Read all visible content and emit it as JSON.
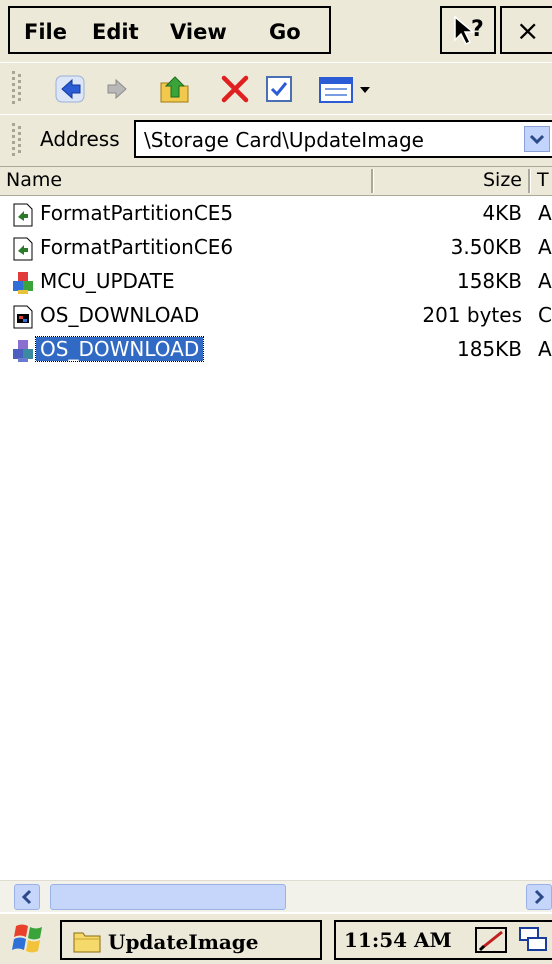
{
  "menu": {
    "file": "File",
    "edit": "Edit",
    "view": "View",
    "go": "Go",
    "help_icon": "help-arrow-icon",
    "close_label": "×"
  },
  "address": {
    "label": "Address",
    "value": "\\Storage Card\\UpdateImage"
  },
  "columns": {
    "name": "Name",
    "size": "Size",
    "type": "T"
  },
  "files": [
    {
      "name": "FormatPartitionCE5",
      "size": "4KB",
      "type": "A",
      "icon": "shortcut-file-icon"
    },
    {
      "name": "FormatPartitionCE6",
      "size": "3.50KB",
      "type": "A",
      "icon": "shortcut-file-icon"
    },
    {
      "name": "MCU_UPDATE",
      "size": "158KB",
      "type": "A",
      "icon": "application-icon"
    },
    {
      "name": "OS_DOWNLOAD",
      "size": "201 bytes",
      "type": "C",
      "icon": "script-file-icon"
    },
    {
      "name": "OS_DOWNLOAD",
      "size": "185KB",
      "type": "A",
      "icon": "application-icon",
      "selected": true
    }
  ],
  "taskbar": {
    "task_label": "UpdateImage",
    "clock": "11:54 AM"
  },
  "colors": {
    "chrome": "#ece9d8",
    "selection": "#316ac5",
    "scroll": "#c6d6fb"
  }
}
